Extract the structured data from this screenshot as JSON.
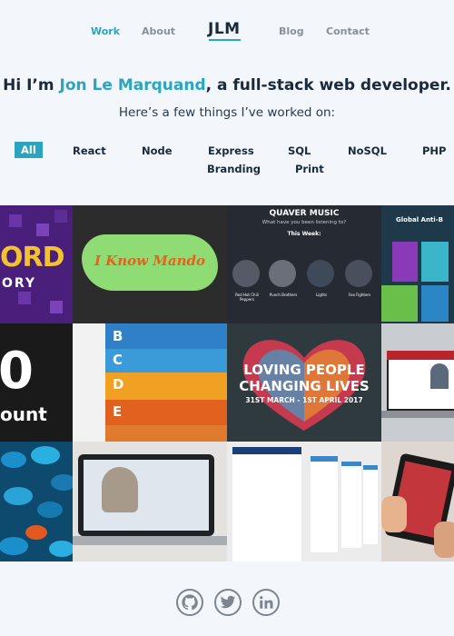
{
  "nav": {
    "work": "Work",
    "about": "About",
    "logo": "JLM",
    "blog": "Blog",
    "contact": "Contact"
  },
  "hero": {
    "prefix": "Hi I’m ",
    "name": "Jon Le Marquand",
    "suffix": ", a full-stack web developer.",
    "subtitle": "Here’s a few things I’ve worked on:"
  },
  "filters": [
    "All",
    "React",
    "Node",
    "Express",
    "SQL",
    "NoSQL",
    "PHP",
    "Branding",
    "Print"
  ],
  "tiles": {
    "ord_big": "ORD",
    "ord_small": "ORY",
    "mando": "I Know Mando",
    "quaver_title": "QUAVER MUSIC",
    "quaver_sub": "What have you been listening to?",
    "quaver_week": "This Week:",
    "quaver_bands": [
      "Red Hot Chili Peppers",
      "Punch Brothers",
      "Lights",
      "Foo Fighters"
    ],
    "global_title": "Global Anti-B",
    "alpha_letters": [
      "B",
      "C",
      "D",
      "E"
    ],
    "count_big": "0",
    "count_small": "ount",
    "loving_line1": "LOVING PEOPLE",
    "loving_line2": "CHANGING LIVES",
    "loving_date": "31ST MARCH - 1ST APRIL 2017"
  },
  "social": {
    "github": "github-icon",
    "twitter": "twitter-icon",
    "linkedin": "linkedin-icon"
  },
  "colors": {
    "accent": "#2aa5c1",
    "heading": "#1a2a3c",
    "background": "#f3f6fa"
  }
}
